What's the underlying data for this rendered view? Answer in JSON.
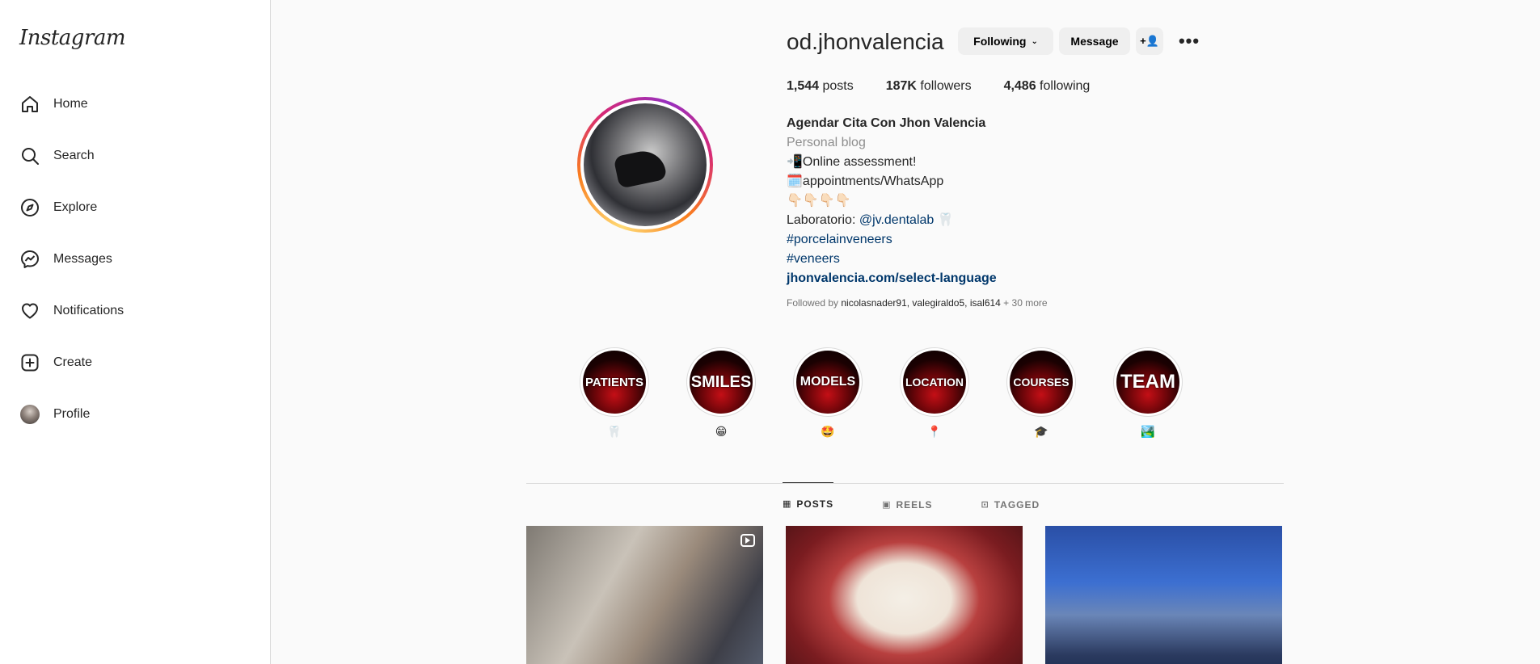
{
  "sidebar": {
    "logo": "Instagram",
    "items": [
      {
        "label": "Home",
        "icon": "home-icon"
      },
      {
        "label": "Search",
        "icon": "search-icon"
      },
      {
        "label": "Explore",
        "icon": "compass-icon"
      },
      {
        "label": "Messages",
        "icon": "messenger-icon"
      },
      {
        "label": "Notifications",
        "icon": "heart-icon"
      },
      {
        "label": "Create",
        "icon": "plus-square-icon"
      },
      {
        "label": "Profile",
        "icon": "avatar"
      }
    ]
  },
  "profile": {
    "username": "od.jhonvalencia",
    "following_button": "Following",
    "message_button": "Message",
    "add_user_button": "+👤",
    "stats": {
      "posts_count": "1,544",
      "posts_label": " posts",
      "followers_count": "187K",
      "followers_label": " followers",
      "following_count": "4,486",
      "following_label": " following"
    },
    "bio": {
      "name": "Agendar Cita Con Jhon Valencia",
      "category": "Personal blog",
      "line1": "📲Online assessment!",
      "line2": "🗓️appointments/WhatsApp",
      "line3": "👇🏻👇🏻👇🏻👇🏻",
      "line4_prefix": "Laboratorio: ",
      "line4_link": "@jv.dentalab",
      "line4_suffix": " 🦷",
      "tag1": "#porcelainveneers",
      "tag2": "#veneers",
      "website": "jhonvalencia.com/select-language"
    },
    "followed_by": {
      "prefix": "Followed by ",
      "names": "nicolasnader91, valegiraldo5, isal614",
      "suffix": " + 30 more"
    }
  },
  "highlights": [
    {
      "title": "PATIENTS",
      "label": "🦷"
    },
    {
      "title": "SMILES",
      "label": "😁"
    },
    {
      "title": "MODELS",
      "label": "🤩"
    },
    {
      "title": "LOCATION",
      "label": "📍"
    },
    {
      "title": "COURSES",
      "label": "🎓"
    },
    {
      "title": "TEAM",
      "label": "🏞️"
    }
  ],
  "tabs": [
    {
      "label": "POSTS",
      "icon": "grid-icon",
      "active": true
    },
    {
      "label": "REELS",
      "icon": "reels-icon",
      "active": false
    },
    {
      "label": "TAGGED",
      "icon": "tagged-icon",
      "active": false
    }
  ]
}
